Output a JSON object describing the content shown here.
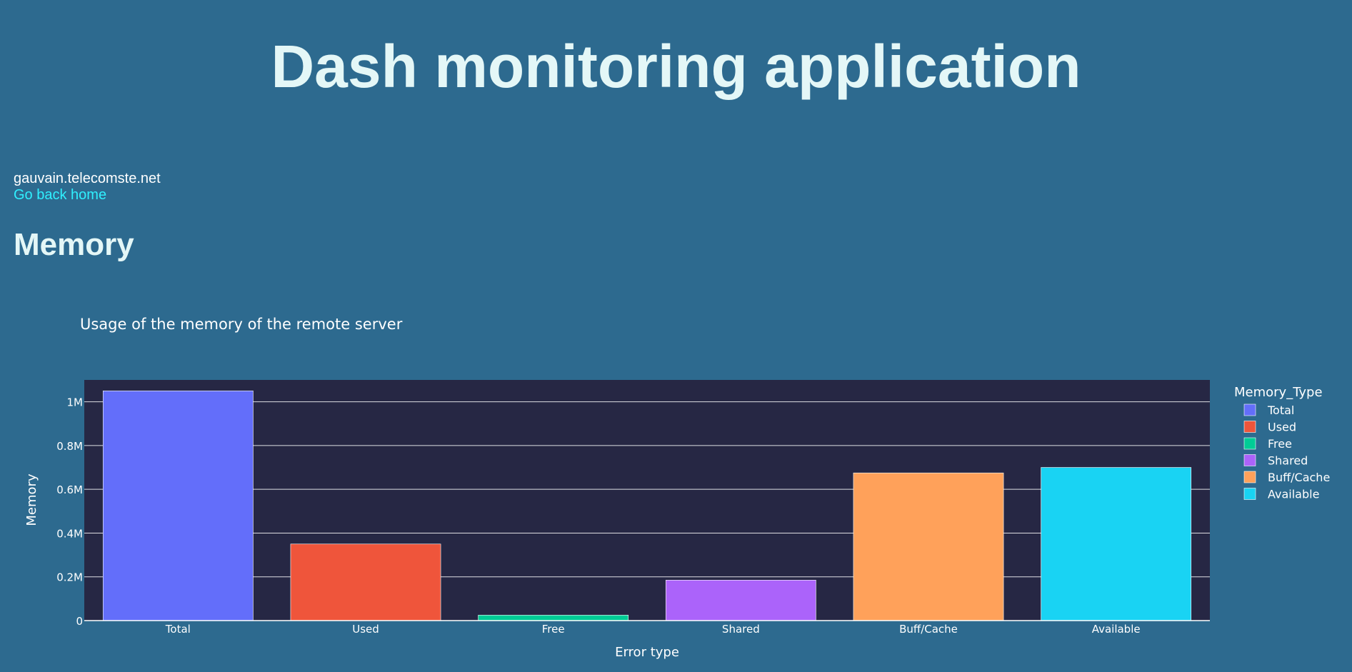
{
  "header": {
    "title": "Dash monitoring application"
  },
  "host": {
    "name": "gauvain.telecomste.net",
    "home_link": "Go back home"
  },
  "section": {
    "title": "Memory"
  },
  "colors": {
    "page_bg": "#2d6a8f",
    "plot_bg": "#262744",
    "title_color": "#e4f7f7",
    "link_color": "#2ff0ff",
    "grid": "#ffffff"
  },
  "chart_data": {
    "type": "bar",
    "title": "Usage of the memory of the remote server",
    "xlabel": "Error type",
    "ylabel": "Memory",
    "categories": [
      "Total",
      "Used",
      "Free",
      "Shared",
      "Buff/Cache",
      "Available"
    ],
    "values": [
      1050000,
      350000,
      25000,
      185000,
      675000,
      700000
    ],
    "colors": [
      "#636efa",
      "#ef553b",
      "#00cc96",
      "#ab63fa",
      "#ffa15a",
      "#19d3f3"
    ],
    "ylim": [
      0,
      1100000
    ],
    "yticks": [
      0,
      200000,
      400000,
      600000,
      800000,
      1000000
    ],
    "ytick_labels": [
      "0",
      "0.2M",
      "0.4M",
      "0.6M",
      "0.8M",
      "1M"
    ],
    "grid": true,
    "legend": {
      "title": "Memory_Type",
      "placement": "right",
      "entries": [
        "Total",
        "Used",
        "Free",
        "Shared",
        "Buff/Cache",
        "Available"
      ]
    }
  }
}
